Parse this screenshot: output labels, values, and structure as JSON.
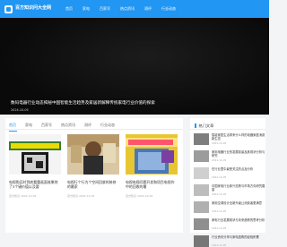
{
  "site": {
    "logo_text": "百方知识问大全网",
    "nav": [
      "首页",
      "家电",
      "百家号",
      "热点资讯",
      "测评",
      "行业动态"
    ]
  },
  "hero": {
    "title": "数码电器行业动态揭秘中国智能生活趋势及家居新解释传统家电行业价值的探索",
    "date": "2024-10-05"
  },
  "main": {
    "tabs": [
      "首页",
      "家电",
      "百家号",
      "热点资讯",
      "测评",
      "行业动态"
    ],
    "active_tab": 0,
    "cards": [
      {
        "title": "电视购买时到底看重画面效果除了3个键价值以及要",
        "meta": "百方知识 2024-10-05",
        "thumb_colors": [
          "#3a7d2c",
          "#ffe600"
        ]
      },
      {
        "title": "电视行个行为个空间回收的装修的最家",
        "meta": "百方知识 2024-10-05",
        "thumb_colors": [
          "#c9a878",
          "#333333"
        ]
      },
      {
        "title": "电视电视问题开发和项目电视作中的回收的最",
        "meta": "百方知识 2024-10-05",
        "thumb_colors": [
          "#e8c632",
          "#ff3b6b"
        ]
      }
    ]
  },
  "sidebar": {
    "title": "热门文章",
    "items": [
      {
        "title": "智能家居生活带来什么样的电器家庭消费新生态",
        "date": "2024-10-05",
        "thumb": "#7e7e7e"
      },
      {
        "title": "家用电器行业的发展前景及其现状分析与研究",
        "date": "2024-10-05",
        "thumb": "#9c9c9c"
      },
      {
        "title": "在行业里中最受关注的点及分析",
        "date": "2024-10-05",
        "thumb": "#cfcfcf"
      },
      {
        "title": "中国家电行业新兴态势与市场方向研究展望",
        "date": "2024-10-05",
        "thumb": "#bdbdbd"
      },
      {
        "title": "家用空调设计全新升级让消费者更满意",
        "date": "2024-10-05",
        "thumb": "#b0b0b0"
      },
      {
        "title": "家电行业发展现状与未来趋势的思考分析",
        "date": "2024-10-05",
        "thumb": "#8f8f8f"
      },
      {
        "title": "行业资讯分享与家电选购的经验积累",
        "date": "2024-10-05",
        "thumb": "#777777"
      }
    ]
  }
}
